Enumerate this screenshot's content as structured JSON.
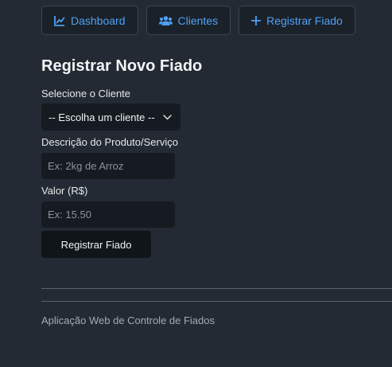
{
  "nav": {
    "dashboard": {
      "label": "Dashboard",
      "icon": "chart-line-icon"
    },
    "clientes": {
      "label": "Clientes",
      "icon": "users-icon"
    },
    "registrar": {
      "label": "Registrar Fiado",
      "icon": "plus-icon"
    },
    "accent_color": "#4ea1f5"
  },
  "form": {
    "title": "Registrar Novo Fiado",
    "client_label": "Selecione o Cliente",
    "client_value": "-- Escolha um cliente --",
    "description_label": "Descrição do Produto/Serviço",
    "description_placeholder": "Ex: 2kg de Arroz",
    "value_label": "Valor (R$)",
    "value_placeholder": "Ex: 15.50",
    "submit_label": "Registrar Fiado"
  },
  "footer": {
    "text": "Aplicação Web de Controle de Fiados"
  },
  "colors": {
    "background": "#232a33",
    "input_background": "#161b21"
  }
}
